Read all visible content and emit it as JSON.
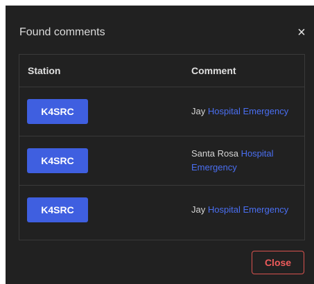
{
  "modal": {
    "title": "Found comments",
    "close_icon": "close-icon",
    "close_glyph": "×"
  },
  "table": {
    "headers": {
      "station": "Station",
      "comment": "Comment"
    },
    "rows": [
      {
        "station": "K4SRC",
        "comment_plain": "Jay",
        "comment_highlight_1": "Hospital",
        "comment_highlight_2": "Emergency"
      },
      {
        "station": "K4SRC",
        "comment_plain": "Santa Rosa",
        "comment_highlight_1": "Hospital",
        "comment_highlight_2": "Emergency"
      },
      {
        "station": "K4SRC",
        "comment_plain": "Jay",
        "comment_highlight_1": "Hospital",
        "comment_highlight_2": "Emergency"
      }
    ]
  },
  "footer": {
    "close_label": "Close"
  },
  "colors": {
    "modal_bg": "#212121",
    "station_button": "#3f5fe0",
    "highlight_text": "#4a6ff2",
    "close_button_border": "#d9534f"
  }
}
